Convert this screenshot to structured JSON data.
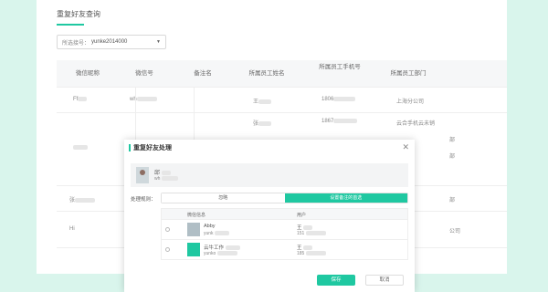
{
  "page": {
    "title": "重复好友查询",
    "select": {
      "label": "所选接号：",
      "value": "yunke2014000",
      "arrow": "▼"
    }
  },
  "table": {
    "headers": [
      "微信昵称",
      "微信号",
      "备注名",
      "所属员工姓名",
      "所属员工手机号",
      "所属员工部门"
    ],
    "rows": [
      {
        "nickname": "Ff",
        "wechat": "wh",
        "employee": "王",
        "phone": "1806",
        "dept": "上海分公司"
      },
      {
        "nickname": "",
        "wechat": "",
        "employee": "张",
        "phone": "1867",
        "dept": "云合手机云未销"
      },
      {
        "nickname": "张",
        "wechat": "",
        "employee": "",
        "phone": "",
        "dept": ""
      },
      {
        "nickname": "Hi",
        "wechat": "",
        "employee": "",
        "phone": "",
        "dept": ""
      },
      {
        "nickname": "张",
        "wechat": "",
        "employee": "",
        "phone": "",
        "dept": ""
      }
    ],
    "dept_fragments": [
      "部",
      "部",
      "部",
      "公司"
    ]
  },
  "modal": {
    "title": "重复好友处理",
    "close": "✕",
    "contact": {
      "name": "邱",
      "id": "wh"
    },
    "method_label": "处理规则：",
    "options": [
      "忽略",
      "设置备注的首选"
    ],
    "friends_headers": [
      "微信信息",
      "用户"
    ],
    "friends": [
      {
        "name": "Abby",
        "id": "yunk",
        "user": "王",
        "phone": "151"
      },
      {
        "name": "云牛工作",
        "id": "yunko",
        "user": "王",
        "phone": "185"
      }
    ],
    "save": "保存",
    "cancel": "取消"
  },
  "colors": {
    "accent": "#1fc8a1",
    "deco": "#d9f5ec"
  }
}
